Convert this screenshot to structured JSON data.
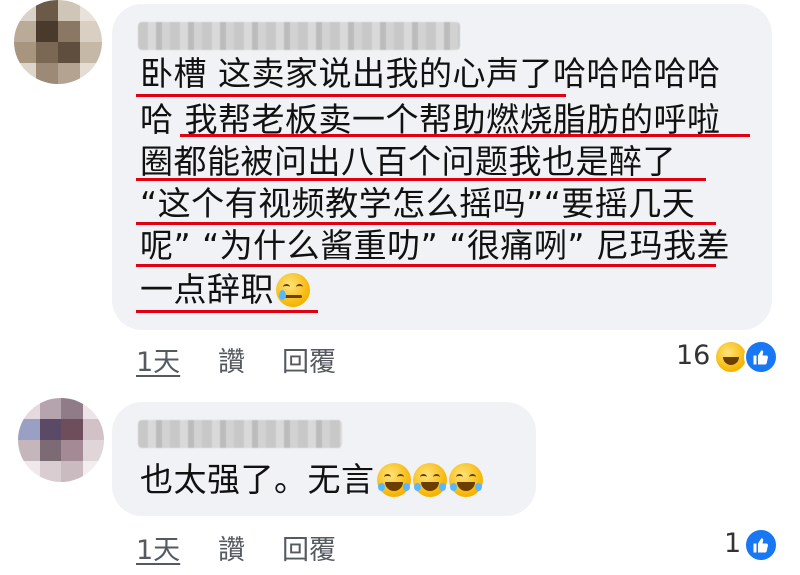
{
  "comments": [
    {
      "author_redacted": true,
      "lines": [
        "卧槽 这卖家说出我的心声了哈哈哈哈哈",
        "哈 我帮老板卖一个帮助燃烧脂肪的呼啦",
        "圈都能被问出八百个问题我也是醉了",
        "“这个有视频教学怎么摇吗”“要摇几天",
        "呢” “为什么酱重叻” “很痛咧” 尼玛我差",
        "一点辞职"
      ],
      "trailing_emoji": "crying-face",
      "time": "1天",
      "like_label": "讚",
      "reply_label": "回覆",
      "reaction_count": "16",
      "reactions": [
        "haha",
        "like"
      ]
    },
    {
      "author_redacted": true,
      "text": "也太强了。无言",
      "trailing_emojis": [
        "laughing-tears",
        "laughing-tears",
        "laughing-tears"
      ],
      "time": "1天",
      "like_label": "讚",
      "reply_label": "回覆",
      "reaction_count": "1",
      "reactions": [
        "like"
      ]
    }
  ],
  "colors": {
    "bubble": "#f0f2f5",
    "underline": "#e00012",
    "like_blue": "#1877f2",
    "meta_text": "#555a61"
  }
}
